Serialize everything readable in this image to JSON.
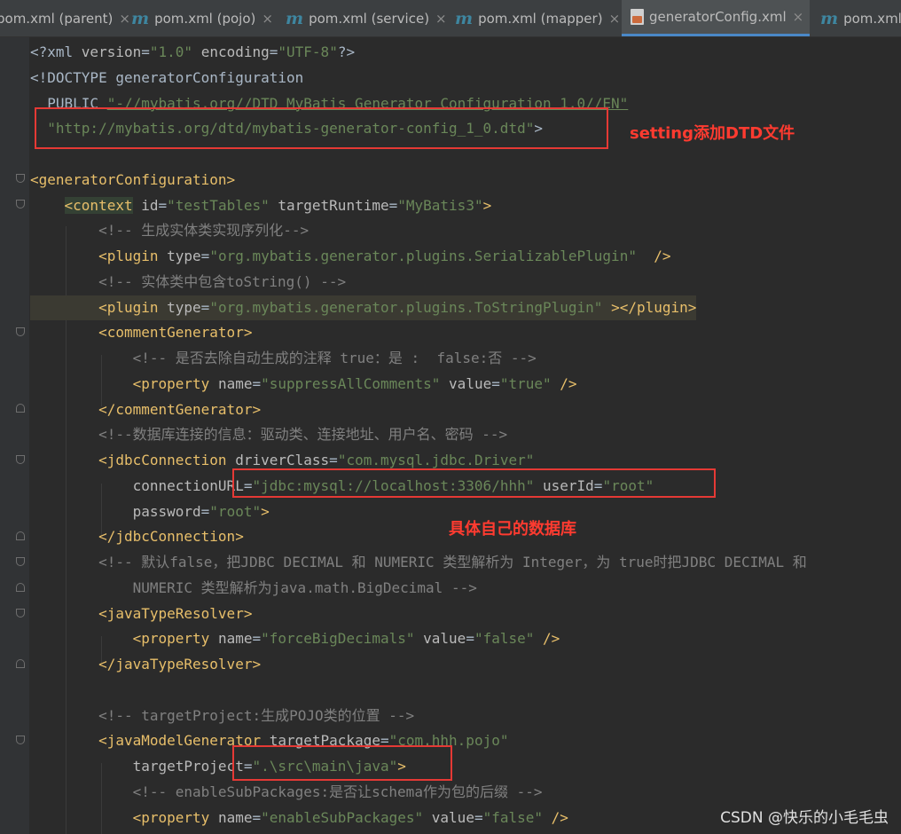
{
  "tabs": [
    {
      "icon": "maven-icon",
      "label": "pom.xml (parent)",
      "active": false
    },
    {
      "icon": "maven-icon",
      "label": "pom.xml (pojo)",
      "active": false
    },
    {
      "icon": "maven-icon",
      "label": "pom.xml (service)",
      "active": false
    },
    {
      "icon": "maven-icon",
      "label": "pom.xml (mapper)",
      "active": false
    },
    {
      "icon": "xml-file-icon",
      "label": "generatorConfig.xml",
      "active": true
    },
    {
      "icon": "maven-icon",
      "label": "pom.xml",
      "active": false
    }
  ],
  "tab_icon_glyph": "m",
  "close_glyph": "×",
  "code_lines": [
    [
      [
        "plain",
        "<?xml "
      ],
      [
        "attr",
        "version"
      ],
      [
        "plain",
        "="
      ],
      [
        "val",
        "\"1.0\""
      ],
      [
        "plain",
        " "
      ],
      [
        "attr",
        "encoding"
      ],
      [
        "plain",
        "="
      ],
      [
        "val",
        "\"UTF-8\""
      ],
      [
        "plain",
        "?>"
      ]
    ],
    [
      [
        "plain",
        "<!DOCTYPE generatorConfiguration"
      ]
    ],
    [
      [
        "plain",
        "  PUBLIC "
      ],
      [
        "val",
        "\"-//mybatis.org//DTD MyBatis Generator Configuration 1.0//EN\""
      ]
    ],
    [
      [
        "val",
        "  \"http://mybatis.org/dtd/mybatis-generator-config_1_0.dtd\""
      ],
      [
        "plain",
        ">"
      ]
    ],
    [
      [
        "plain",
        ""
      ]
    ],
    [
      [
        "tag",
        "<generatorConfiguration>"
      ]
    ],
    [
      [
        "plain",
        "    "
      ],
      [
        "tag",
        "<context"
      ],
      [
        "plain",
        " "
      ],
      [
        "attr",
        "id"
      ],
      [
        "plain",
        "="
      ],
      [
        "val",
        "\"testTables\""
      ],
      [
        "plain",
        " "
      ],
      [
        "attr",
        "targetRuntime"
      ],
      [
        "plain",
        "="
      ],
      [
        "val",
        "\"MyBatis3\""
      ],
      [
        "tag",
        ">"
      ]
    ],
    [
      [
        "cmt",
        "        <!-- 生成实体类实现序列化-->"
      ]
    ],
    [
      [
        "tag",
        "        <plugin"
      ],
      [
        "plain",
        " "
      ],
      [
        "attr",
        "type"
      ],
      [
        "plain",
        "="
      ],
      [
        "val",
        "\"org.mybatis.generator.plugins.SerializablePlugin\""
      ],
      [
        "plain",
        "  "
      ],
      [
        "tag",
        "/>"
      ]
    ],
    [
      [
        "cmt",
        "        <!-- 实体类中包含toString() -->"
      ]
    ],
    [
      [
        "tag",
        "        <plugin"
      ],
      [
        "plain",
        " "
      ],
      [
        "attr",
        "type"
      ],
      [
        "plain",
        "="
      ],
      [
        "val",
        "\"org.mybatis.generator.plugins.ToStringPlugin\""
      ],
      [
        "plain",
        " "
      ],
      [
        "tag",
        "></plugin>"
      ]
    ],
    [
      [
        "tag",
        "        <commentGenerator>"
      ]
    ],
    [
      [
        "cmt",
        "            <!-- 是否去除自动生成的注释 true：是 :  false:否 -->"
      ]
    ],
    [
      [
        "tag",
        "            <property"
      ],
      [
        "plain",
        " "
      ],
      [
        "attr",
        "name"
      ],
      [
        "plain",
        "="
      ],
      [
        "val",
        "\"suppressAllComments\""
      ],
      [
        "plain",
        " "
      ],
      [
        "attr",
        "value"
      ],
      [
        "plain",
        "="
      ],
      [
        "val",
        "\"true\""
      ],
      [
        "plain",
        " "
      ],
      [
        "tag",
        "/>"
      ]
    ],
    [
      [
        "tag",
        "        </commentGenerator>"
      ]
    ],
    [
      [
        "cmt",
        "        <!--数据库连接的信息：驱动类、连接地址、用户名、密码 -->"
      ]
    ],
    [
      [
        "tag",
        "        <jdbcConnection"
      ],
      [
        "plain",
        " "
      ],
      [
        "attr",
        "driverClass"
      ],
      [
        "plain",
        "="
      ],
      [
        "val",
        "\"com.mysql.jdbc.Driver\""
      ]
    ],
    [
      [
        "plain",
        "            "
      ],
      [
        "attr",
        "connectionURL"
      ],
      [
        "plain",
        "="
      ],
      [
        "val",
        "\"jdbc:mysql://localhost:3306/hhh\""
      ],
      [
        "plain",
        " "
      ],
      [
        "attr",
        "userId"
      ],
      [
        "plain",
        "="
      ],
      [
        "val",
        "\"root\""
      ]
    ],
    [
      [
        "plain",
        "            "
      ],
      [
        "attr",
        "password"
      ],
      [
        "plain",
        "="
      ],
      [
        "val",
        "\"root\""
      ],
      [
        "tag",
        ">"
      ]
    ],
    [
      [
        "tag",
        "        </jdbcConnection>"
      ]
    ],
    [
      [
        "cmt",
        "        <!-- 默认false，把JDBC DECIMAL 和 NUMERIC 类型解析为 Integer，为 true时把JDBC DECIMAL 和"
      ]
    ],
    [
      [
        "cmt",
        "            NUMERIC 类型解析为java.math.BigDecimal -->"
      ]
    ],
    [
      [
        "tag",
        "        <javaTypeResolver>"
      ]
    ],
    [
      [
        "tag",
        "            <property"
      ],
      [
        "plain",
        " "
      ],
      [
        "attr",
        "name"
      ],
      [
        "plain",
        "="
      ],
      [
        "val",
        "\"forceBigDecimals\""
      ],
      [
        "plain",
        " "
      ],
      [
        "attr",
        "value"
      ],
      [
        "plain",
        "="
      ],
      [
        "val",
        "\"false\""
      ],
      [
        "plain",
        " "
      ],
      [
        "tag",
        "/>"
      ]
    ],
    [
      [
        "tag",
        "        </javaTypeResolver>"
      ]
    ],
    [
      [
        "plain",
        ""
      ]
    ],
    [
      [
        "cmt",
        "        <!-- targetProject:生成POJO类的位置 -->"
      ]
    ],
    [
      [
        "tag",
        "        <javaModelGenerator"
      ],
      [
        "plain",
        " "
      ],
      [
        "attr",
        "targetPackage"
      ],
      [
        "plain",
        "="
      ],
      [
        "val",
        "\"com.hhh.pojo\""
      ]
    ],
    [
      [
        "plain",
        "            "
      ],
      [
        "attr",
        "targetProject"
      ],
      [
        "plain",
        "="
      ],
      [
        "val",
        "\".\\src\\main\\java\""
      ],
      [
        "tag",
        ">"
      ]
    ],
    [
      [
        "cmt",
        "            <!-- enableSubPackages:是否让schema作为包的后缀 -->"
      ]
    ],
    [
      [
        "tag",
        "            <property"
      ],
      [
        "plain",
        " "
      ],
      [
        "attr",
        "name"
      ],
      [
        "plain",
        "="
      ],
      [
        "val",
        "\"enableSubPackages\""
      ],
      [
        "plain",
        " "
      ],
      [
        "attr",
        "value"
      ],
      [
        "plain",
        "="
      ],
      [
        "val",
        "\"false\""
      ],
      [
        "plain",
        " "
      ],
      [
        "tag",
        "/>"
      ]
    ]
  ],
  "annotations": {
    "dtd_note": "setting添加DTD文件",
    "db_note": "具体自己的数据库"
  },
  "watermark": "CSDN @快乐的小毛毛虫"
}
